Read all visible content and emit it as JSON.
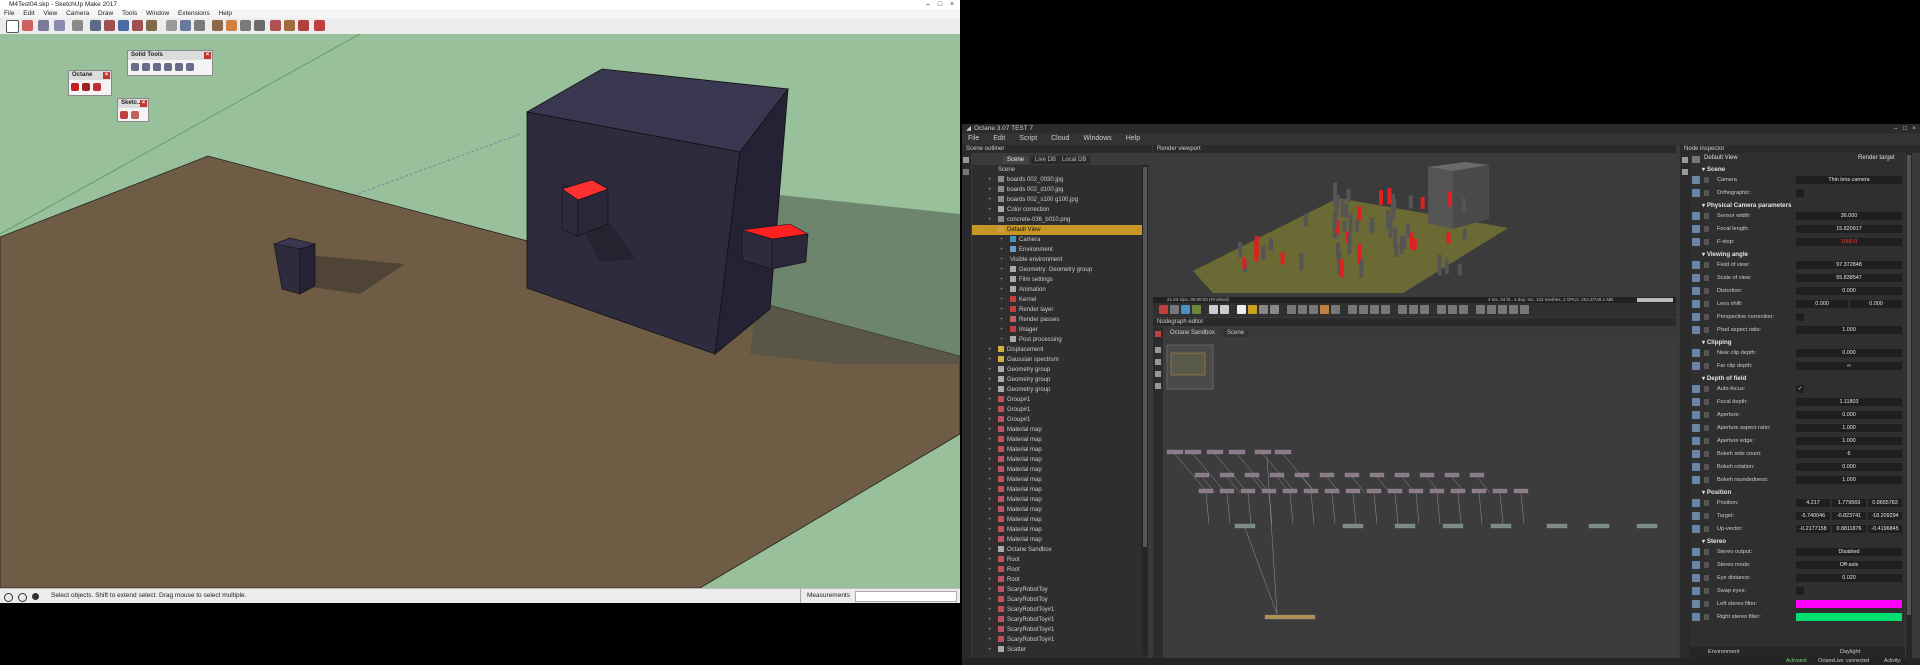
{
  "sketchup": {
    "title": "M4Test04.skp - SketchUp Make 2017",
    "menu": [
      "File",
      "Edit",
      "View",
      "Camera",
      "Draw",
      "Tools",
      "Window",
      "Extensions",
      "Help"
    ],
    "palettes": {
      "octane": {
        "title": "Octane"
      },
      "solid_tools": {
        "title": "Solid Tools"
      },
      "sketch": {
        "title": "Sketc.."
      }
    },
    "status_text": "Select objects. Shift to extend select. Drag mouse to select multiple.",
    "measurements_label": "Measurements",
    "colors": {
      "sky": "#98c09a",
      "ground": "#6e5c45",
      "box": "#2e2b3e",
      "accent": "#e02020"
    }
  },
  "octane": {
    "title": "Octane 3.07 TEST 7",
    "menu": [
      "File",
      "Edit",
      "Script",
      "Cloud",
      "Windows",
      "Help"
    ],
    "outliner": {
      "header": "Scene outliner",
      "tabs": [
        "Scene",
        "Live DB",
        "Local DB"
      ],
      "root": "Scene",
      "items": [
        {
          "label": "boards 002_0030.jpg",
          "icon": "image-icon",
          "indent": 1
        },
        {
          "label": "boards 002_d100.jpg",
          "icon": "image-icon",
          "indent": 1
        },
        {
          "label": "boards 002_s100 g100.jpg",
          "icon": "image-icon",
          "indent": 1
        },
        {
          "label": "Color correction",
          "icon": "color-correction-icon",
          "indent": 1
        },
        {
          "label": "concrete-036_b010.png",
          "icon": "image-icon",
          "indent": 1
        },
        {
          "label": "Default View",
          "icon": "view-icon",
          "indent": 1,
          "selected": true
        },
        {
          "label": "Camera",
          "icon": "camera-icon",
          "indent": 2
        },
        {
          "label": "Environment",
          "icon": "environment-icon",
          "indent": 2
        },
        {
          "label": "Visible environment",
          "icon": "",
          "indent": 2
        },
        {
          "label": "Geometry: Geometry group",
          "icon": "geometry-icon",
          "indent": 2
        },
        {
          "label": "Film settings",
          "icon": "film-icon",
          "indent": 2
        },
        {
          "label": "Animation",
          "icon": "animation-icon",
          "indent": 2
        },
        {
          "label": "Kernel",
          "icon": "kernel-icon",
          "indent": 2
        },
        {
          "label": "Render layer",
          "icon": "layer-icon",
          "indent": 2
        },
        {
          "label": "Render passes",
          "icon": "passes-icon",
          "indent": 2
        },
        {
          "label": "Imager",
          "icon": "imager-icon",
          "indent": 2
        },
        {
          "label": "Post processing",
          "icon": "post-icon",
          "indent": 2
        },
        {
          "label": "Displacement",
          "icon": "displacement-icon",
          "indent": 1
        },
        {
          "label": "Gaussian spectrum",
          "icon": "spectrum-icon",
          "indent": 1
        },
        {
          "label": "Geometry group",
          "icon": "geometry-icon",
          "indent": 1
        },
        {
          "label": "Geometry group",
          "icon": "geometry-icon",
          "indent": 1
        },
        {
          "label": "Geometry group",
          "icon": "geometry-icon",
          "indent": 1
        },
        {
          "label": "Group#1",
          "icon": "material-icon",
          "indent": 1
        },
        {
          "label": "Group#1",
          "icon": "material-icon",
          "indent": 1
        },
        {
          "label": "Group#1",
          "icon": "material-icon",
          "indent": 1
        },
        {
          "label": "Material map",
          "icon": "material-icon",
          "indent": 1
        },
        {
          "label": "Material map",
          "icon": "material-icon",
          "indent": 1
        },
        {
          "label": "Material map",
          "icon": "material-icon",
          "indent": 1
        },
        {
          "label": "Material map",
          "icon": "material-icon",
          "indent": 1
        },
        {
          "label": "Material map",
          "icon": "material-icon",
          "indent": 1
        },
        {
          "label": "Material map",
          "icon": "material-icon",
          "indent": 1
        },
        {
          "label": "Material map",
          "icon": "material-icon",
          "indent": 1
        },
        {
          "label": "Material map",
          "icon": "material-icon",
          "indent": 1
        },
        {
          "label": "Material map",
          "icon": "material-icon",
          "indent": 1
        },
        {
          "label": "Material map",
          "icon": "material-icon",
          "indent": 1
        },
        {
          "label": "Material map",
          "icon": "material-icon",
          "indent": 1
        },
        {
          "label": "Material map",
          "icon": "material-icon",
          "indent": 1
        },
        {
          "label": "Octane Sandbox",
          "icon": "sandbox-icon",
          "indent": 1
        },
        {
          "label": "Root",
          "icon": "material-icon",
          "indent": 1
        },
        {
          "label": "Root",
          "icon": "material-icon",
          "indent": 1
        },
        {
          "label": "Root",
          "icon": "material-icon",
          "indent": 1
        },
        {
          "label": "ScaryRobotToy",
          "icon": "material-icon",
          "indent": 1
        },
        {
          "label": "ScaryRobotToy",
          "icon": "material-icon",
          "indent": 1
        },
        {
          "label": "ScaryRobotToy#1",
          "icon": "material-icon",
          "indent": 1
        },
        {
          "label": "ScaryRobotToy#1",
          "icon": "material-icon",
          "indent": 1
        },
        {
          "label": "ScaryRobotToy#1",
          "icon": "material-icon",
          "indent": 1
        },
        {
          "label": "ScaryRobotToy#1",
          "icon": "material-icon",
          "indent": 1
        },
        {
          "label": "Scatter",
          "icon": "scatter-icon",
          "indent": 1
        }
      ]
    },
    "viewport": {
      "header": "Render viewport",
      "status_left": "21.53 s/px, 00:00:03 (Finished)",
      "status_right": "4 tex, 34 ht., 4 dsp. tris, 122 meshes, 2 GPUs, 263.3/749.1 MB"
    },
    "nodegraph": {
      "header": "Nodegraph editor",
      "tabs": [
        "Octane Sandbox",
        "Scene"
      ]
    },
    "inspector": {
      "header": "Node inspector",
      "node": "Default View",
      "node_type": "Render target",
      "sections": [
        {
          "title": "Scene",
          "rows": [
            {
              "label": "Camera",
              "values": [
                "Thin lens camera"
              ]
            }
          ]
        },
        {
          "title": "",
          "rows": [
            {
              "label": "Orthographic:",
              "check": ""
            }
          ]
        },
        {
          "title": "Physical Camera parameters",
          "rows": [
            {
              "label": "Sensor width:",
              "values": [
                "36.000"
              ]
            },
            {
              "label": "Focal length:",
              "values": [
                "15.820917"
              ]
            },
            {
              "label": "F-stop:",
              "values": [
                "1000.0"
              ],
              "red": true
            }
          ]
        },
        {
          "title": "Viewing angle",
          "rows": [
            {
              "label": "Field of view:",
              "values": [
                "97.372848"
              ]
            },
            {
              "label": "Scale of view:",
              "values": [
                "55.838547"
              ]
            },
            {
              "label": "Distortion:",
              "values": [
                "0.000"
              ]
            },
            {
              "label": "Lens shift:",
              "values": [
                "0.000",
                "0.000"
              ]
            },
            {
              "label": "Perspective correction:",
              "check": ""
            },
            {
              "label": "Pixel aspect ratio:",
              "values": [
                "1.000"
              ]
            }
          ]
        },
        {
          "title": "Clipping",
          "rows": [
            {
              "label": "Near clip depth:",
              "values": [
                "0.000"
              ]
            },
            {
              "label": "Far clip depth:",
              "values": [
                "∞"
              ]
            }
          ]
        },
        {
          "title": "Depth of field",
          "rows": [
            {
              "label": "Auto-focus:",
              "check": "✓"
            },
            {
              "label": "Focal depth:",
              "values": [
                "1.11803"
              ]
            },
            {
              "label": "Aperture:",
              "values": [
                "0.000"
              ]
            },
            {
              "label": "Aperture aspect ratio:",
              "values": [
                "1.000"
              ]
            },
            {
              "label": "Aperture edge:",
              "values": [
                "1.000"
              ]
            },
            {
              "label": "Bokeh side count:",
              "values": [
                "6"
              ]
            },
            {
              "label": "Bokeh rotation:",
              "values": [
                "0.000"
              ]
            },
            {
              "label": "Bokeh roundedness:",
              "values": [
                "1.000"
              ]
            }
          ]
        },
        {
          "title": "Position",
          "rows": [
            {
              "label": "Position:",
              "values": [
                "4.217",
                "1.779569",
                "0.8655783"
              ]
            },
            {
              "label": "Target:",
              "values": [
                "-5.740046",
                "-0.823741",
                "-18.209294"
              ]
            },
            {
              "label": "Up-vector:",
              "values": [
                "-0.2177158",
                "0.8811876",
                "-0.4196845"
              ]
            }
          ]
        },
        {
          "title": "Stereo",
          "rows": [
            {
              "label": "Stereo output:",
              "values": [
                "Disabled"
              ]
            },
            {
              "label": "Stereo mode:",
              "values": [
                "Off-axis"
              ]
            },
            {
              "label": "Eye distance:",
              "values": [
                "0.020"
              ]
            },
            {
              "label": "Swap eyes:",
              "check": ""
            },
            {
              "label": "Left stereo filter:",
              "swatch": "#ff00ff"
            },
            {
              "label": "Right stereo filter:",
              "swatch": "#00e070"
            }
          ]
        }
      ],
      "environment": {
        "label": "Environment",
        "value": "Daylight"
      }
    },
    "status": {
      "activated": "Activated",
      "octanelive": "OctaneLive: connected",
      "activity": "Activity:"
    }
  }
}
